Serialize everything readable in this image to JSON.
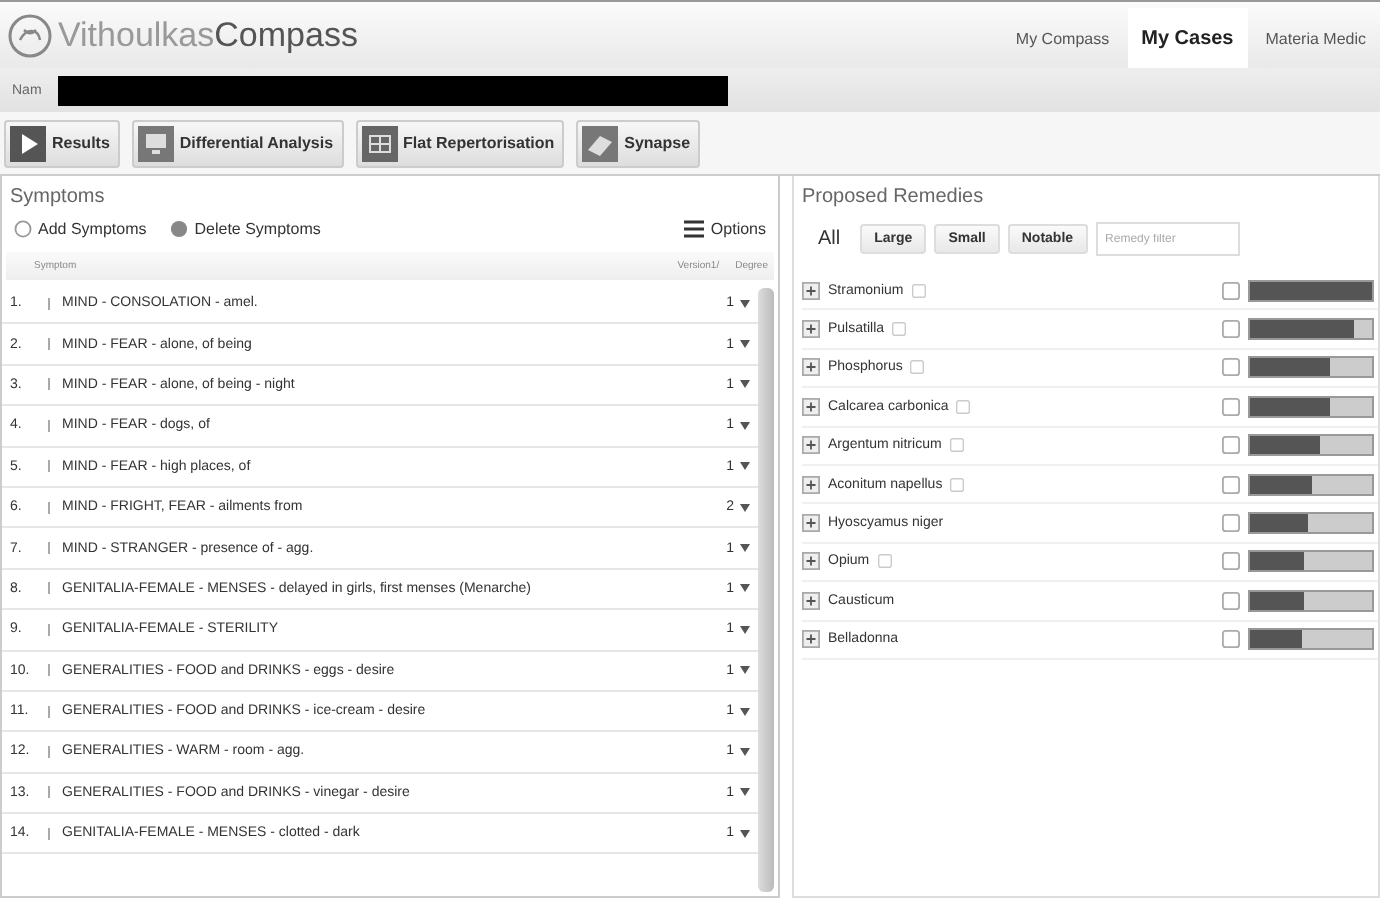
{
  "header": {
    "logo_light": "Vithoulkas",
    "logo_bold": "Compass",
    "tabs": [
      {
        "label": "My Compass",
        "selected": false
      },
      {
        "label": "My Cases",
        "selected": true
      },
      {
        "label": "Materia Medic",
        "selected": false
      }
    ]
  },
  "case": {
    "label": "Nam"
  },
  "toolbar": [
    {
      "label": "Results",
      "kind": "play"
    },
    {
      "label": "Differential Analysis",
      "kind": "monitor"
    },
    {
      "label": "Flat Repertorisation",
      "kind": "grid"
    },
    {
      "label": "Synapse",
      "kind": "book"
    }
  ],
  "symptoms": {
    "title": "Symptoms",
    "add": "Add Symptoms",
    "delete": "Delete Symptoms",
    "options": "Options",
    "columns": [
      "Symptom",
      "Version1/",
      "Degree"
    ],
    "rows": [
      {
        "num": "1.",
        "text": "MIND - CONSOLATION - amel.",
        "degree": "1"
      },
      {
        "num": "2.",
        "text": "MIND - FEAR - alone, of being",
        "degree": "1"
      },
      {
        "num": "3.",
        "text": "MIND - FEAR - alone, of being - night",
        "degree": "1"
      },
      {
        "num": "4.",
        "text": "MIND - FEAR - dogs, of",
        "degree": "1"
      },
      {
        "num": "5.",
        "text": "MIND - FEAR - high places, of",
        "degree": "1"
      },
      {
        "num": "6.",
        "text": "MIND - FRIGHT, FEAR - ailments from",
        "degree": "2"
      },
      {
        "num": "7.",
        "text": "MIND - STRANGER - presence of - agg.",
        "degree": "1"
      },
      {
        "num": "8.",
        "text": "GENITALIA-FEMALE - MENSES - delayed in girls, first menses (Menarche)",
        "degree": "1"
      },
      {
        "num": "9.",
        "text": "GENITALIA-FEMALE - STERILITY",
        "degree": "1"
      },
      {
        "num": "10.",
        "text": "GENERALITIES - FOOD and DRINKS - eggs - desire",
        "degree": "1"
      },
      {
        "num": "11.",
        "text": "GENERALITIES - FOOD and DRINKS - ice-cream - desire",
        "degree": "1"
      },
      {
        "num": "12.",
        "text": "GENERALITIES - WARM - room - agg.",
        "degree": "1"
      },
      {
        "num": "13.",
        "text": "GENERALITIES - FOOD and DRINKS - vinegar - desire",
        "degree": "1"
      },
      {
        "num": "14.",
        "text": "GENITALIA-FEMALE - MENSES - clotted - dark",
        "degree": "1"
      }
    ]
  },
  "remedies": {
    "title": "Proposed Remedies",
    "filters": [
      {
        "label": "All",
        "selected": true
      },
      {
        "label": "Large",
        "selected": false
      },
      {
        "label": "Small",
        "selected": false
      },
      {
        "label": "Notable",
        "selected": false
      }
    ],
    "filter_placeholder": "Remedy filter",
    "items": [
      {
        "name": "Stramonium",
        "info": true,
        "level": 1.0
      },
      {
        "name": "Pulsatilla",
        "info": true,
        "level": 0.85
      },
      {
        "name": "Phosphorus",
        "info": true,
        "level": 0.66
      },
      {
        "name": "Calcarea carbonica",
        "info": true,
        "level": 0.65
      },
      {
        "name": "Argentum nitricum",
        "info": true,
        "level": 0.57
      },
      {
        "name": "Aconitum napellus",
        "info": true,
        "level": 0.5
      },
      {
        "name": "Hyoscyamus niger",
        "info": false,
        "level": 0.48
      },
      {
        "name": "Opium",
        "info": true,
        "level": 0.45
      },
      {
        "name": "Causticum",
        "info": false,
        "level": 0.45
      },
      {
        "name": "Belladonna",
        "info": false,
        "level": 0.42
      }
    ]
  }
}
